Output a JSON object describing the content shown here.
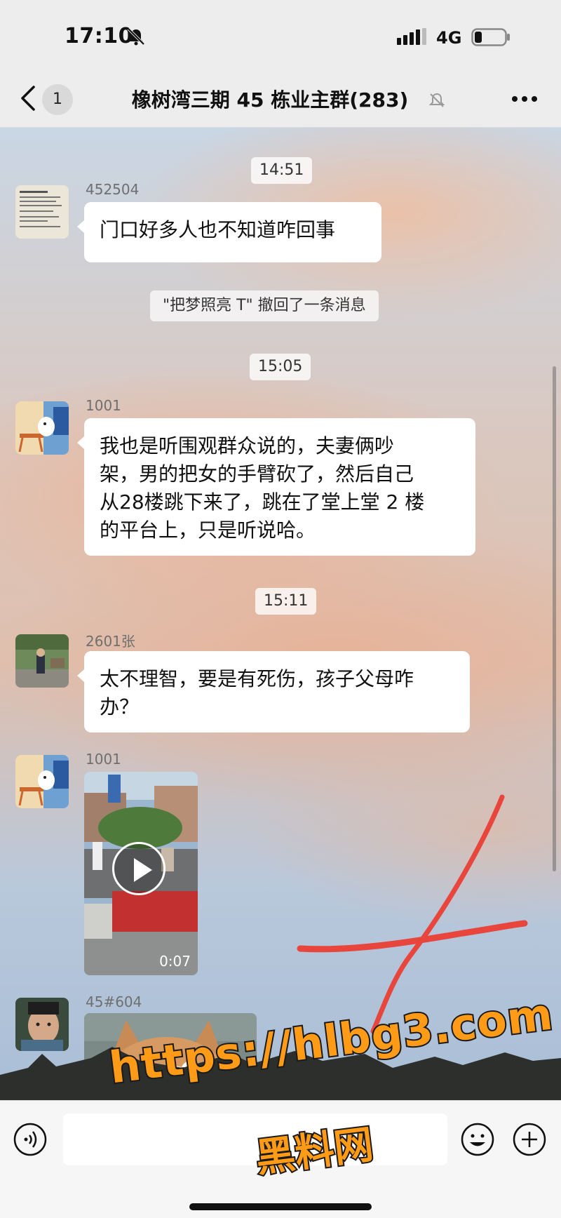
{
  "status_bar": {
    "time": "17:10",
    "network": "4G",
    "icons": [
      "bell-off-icon",
      "signal-icon",
      "battery-icon"
    ]
  },
  "header": {
    "back_icon": "chevron-left-icon",
    "unread_count": "1",
    "title": "橡树湾三期 45 栋业主群(283)",
    "mute_icon": "bell-off-icon",
    "more_icon": "ellipsis-icon"
  },
  "messages": [
    {
      "type": "time",
      "text": "14:51"
    },
    {
      "type": "text",
      "sender": "452504",
      "text": "门口好多人也不知道咋回事"
    },
    {
      "type": "system",
      "text": "\"把梦照亮 T\" 撤回了一条消息"
    },
    {
      "type": "time",
      "text": "15:05"
    },
    {
      "type": "text",
      "sender": "1001",
      "lines": [
        "我也是听围观群众说的，夫妻俩吵",
        "架，男的把女的手臂砍了，然后自己",
        "从28楼跳下来了，跳在了堂上堂 2 楼",
        "的平台上，只是听说哈。"
      ]
    },
    {
      "type": "time",
      "text": "15:11"
    },
    {
      "type": "text",
      "sender": "2601张",
      "lines": [
        "太不理智，要是有死伤，孩子父母咋",
        "办？"
      ]
    },
    {
      "type": "video",
      "sender": "1001",
      "duration": "0:07"
    },
    {
      "type": "image",
      "sender": "45#604"
    }
  ],
  "input_bar": {
    "voice_icon": "voice-icon",
    "emoji_icon": "emoji-icon",
    "plus_icon": "plus-icon",
    "placeholder": ""
  },
  "watermark": {
    "url": "https://hlbg3.com",
    "name": "黑料网"
  },
  "colors": {
    "chat_bubble": "#ffffff",
    "header_bg": "#ededed",
    "watermark": "#ff9b17",
    "annotation_red": "#e8453c"
  }
}
